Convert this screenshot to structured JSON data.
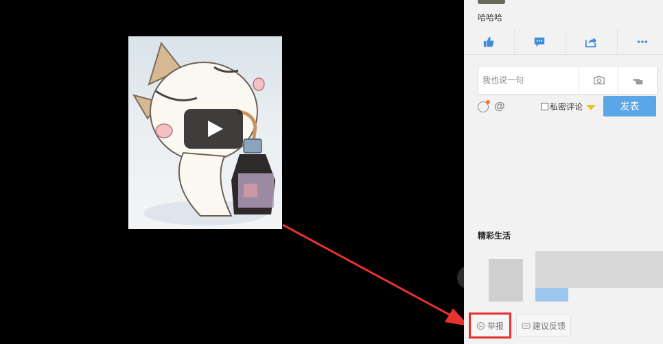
{
  "comment": {
    "text": "哈哈哈"
  },
  "actions": [
    {
      "icon": "thumbs-up-icon"
    },
    {
      "icon": "comment-icon"
    },
    {
      "icon": "share-icon"
    },
    {
      "icon": "more-icon"
    }
  ],
  "reply": {
    "placeholder": "我也说一句"
  },
  "private_comment": {
    "label": "私密评论"
  },
  "send": {
    "label": "发表"
  },
  "section": {
    "title": "精彩生活"
  },
  "bottom": {
    "report_label": "举报",
    "feedback_label": "建议反馈"
  },
  "colors": {
    "accent": "#5aa6e6",
    "highlight": "#e8322f",
    "badge": "#f3c21b"
  }
}
